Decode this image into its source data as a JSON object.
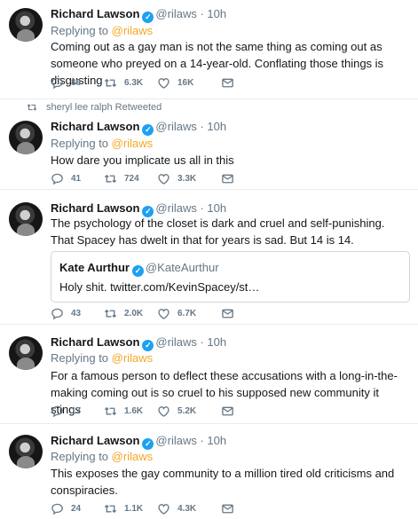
{
  "tweets": [
    {
      "name": "Richard Lawson",
      "handle": "@rilaws",
      "time": "10h",
      "replying_prefix": "Replying to ",
      "replying_to": "@rilaws",
      "text": "Coming out as a gay man is not the same thing as coming out as someone who preyed on a 14-year-old. Conflating those things is disgusting",
      "replies": "86",
      "retweets": "6.3K",
      "likes": "16K"
    },
    {
      "retweet_note": "sheryl lee ralph Retweeted",
      "name": "Richard Lawson",
      "handle": "@rilaws",
      "time": "10h",
      "replying_prefix": "Replying to ",
      "replying_to": "@rilaws",
      "text": "How dare you implicate us all in this",
      "replies": "41",
      "retweets": "724",
      "likes": "3.3K"
    },
    {
      "name": "Richard Lawson",
      "handle": "@rilaws",
      "time": "10h",
      "text": "The psychology of the closet is dark and cruel and self-punishing. That Spacey has dwelt in that for years is sad. But 14 is 14.",
      "quote": {
        "name": "Kate Aurthur",
        "handle": "@KateAurthur",
        "text": "Holy shit. twitter.com/KevinSpacey/st…"
      },
      "replies": "43",
      "retweets": "2.0K",
      "likes": "6.7K"
    },
    {
      "name": "Richard Lawson",
      "handle": "@rilaws",
      "time": "10h",
      "replying_prefix": "Replying to ",
      "replying_to": "@rilaws",
      "text": "For a famous person to deflect these accusations with a long-in-the-making coming out is so cruel to his supposed new community it stings",
      "replies": "17",
      "retweets": "1.6K",
      "likes": "5.2K"
    },
    {
      "name": "Richard Lawson",
      "handle": "@rilaws",
      "time": "10h",
      "replying_prefix": "Replying to ",
      "replying_to": "@rilaws",
      "text": "This exposes the gay community to a million tired old criticisms and conspiracies.",
      "replies": "24",
      "retweets": "1.1K",
      "likes": "4.3K"
    }
  ],
  "icons": {
    "reply": "reply-icon",
    "retweet": "retweet-icon",
    "like": "heart-icon",
    "message": "envelope-icon",
    "verified": "verified-badge-icon"
  },
  "colors": {
    "verified": "#1da1f2",
    "mention": "#f5a623",
    "muted": "#657786",
    "divider": "#e6ecf0"
  }
}
